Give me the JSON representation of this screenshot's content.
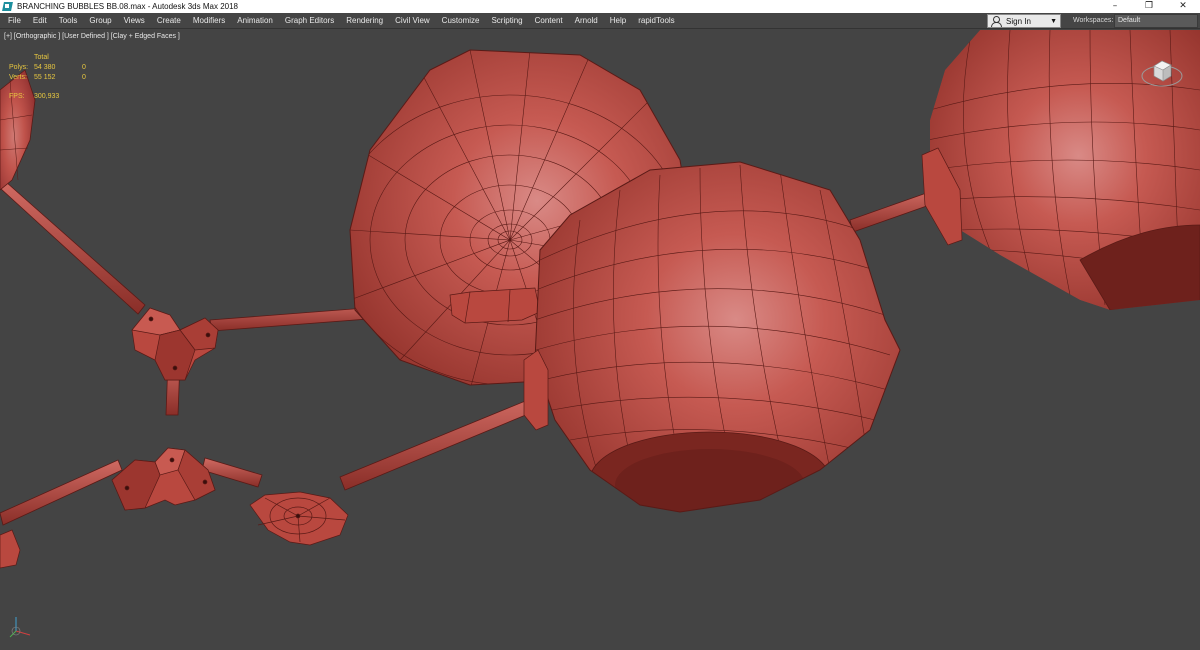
{
  "window": {
    "title": "BRANCHING BUBBLES BB.08.max - Autodesk 3ds Max 2018",
    "controls": [
      "–",
      "❐",
      "✕"
    ]
  },
  "menu": {
    "items": [
      "File",
      "Edit",
      "Tools",
      "Group",
      "Views",
      "Create",
      "Modifiers",
      "Animation",
      "Graph Editors",
      "Rendering",
      "Civil View",
      "Customize",
      "Scripting",
      "Content",
      "Arnold",
      "Help",
      "rapidTools"
    ],
    "sign_in": "Sign In",
    "workspaces_label": "Workspaces:",
    "workspaces_value": "Default"
  },
  "viewport": {
    "label": "[+] [Orthographic ] [User Defined ] [Clay + Edged Faces ]",
    "stats": {
      "header": "Total",
      "rows": [
        {
          "label": "Polys:",
          "value": "54 380",
          "selected": "0"
        },
        {
          "label": "Verts:",
          "value": "55 152",
          "selected": "0"
        }
      ],
      "fps_label": "FPS:",
      "fps_value": "300,933"
    },
    "clay_color": "#c14e45",
    "wire_color": "#5a1a16",
    "background_color": "#444444"
  },
  "icons": {
    "app": "3ds-max-app-icon",
    "user": "user-icon",
    "dropdown": "chevron-down-icon",
    "viewcube": "viewcube-icon",
    "axis": "axis-tripod-icon"
  }
}
